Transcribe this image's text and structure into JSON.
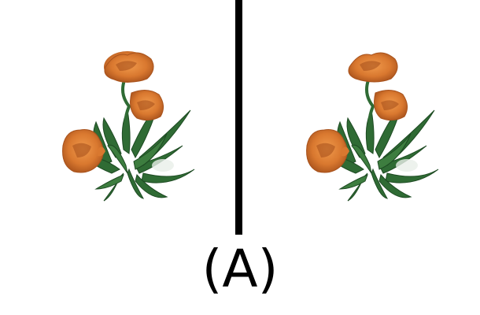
{
  "panels": [
    {
      "subject": "orange-flower-plant"
    },
    {
      "subject": "orange-flower-plant"
    }
  ],
  "caption": "(A)",
  "colors": {
    "background": "#ffffff",
    "divider": "#000000",
    "petal": "#d9782f",
    "petal_dark": "#a8521c",
    "leaf": "#2f6b34",
    "leaf_dark": "#1d4a22"
  }
}
